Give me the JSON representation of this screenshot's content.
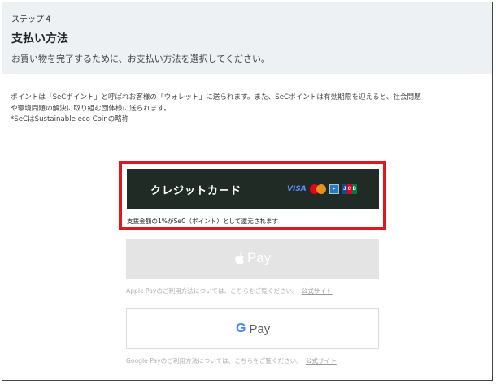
{
  "header": {
    "step": "ステップ４",
    "title": "支払い方法",
    "subtitle": "お買い物を完了するために、お支払い方法を選択してください。"
  },
  "description": {
    "line1": "ポイントは「SeCポイント」と呼ばれお客様の「ウォレット」に送られます。また、SeCポイントは有効期限を迎えると、社会問題",
    "line2": "や環境問題の解決に取り組む団体様に送られます。",
    "line3": "*SeCはSustainable eco Coinの略称"
  },
  "credit_card": {
    "label": "クレジットカード",
    "visa": "VISA",
    "jcb": [
      "J",
      "C",
      "B"
    ],
    "note": "支援金額の1%がSeC（ポイント）として還元されます"
  },
  "apple_pay": {
    "label": "Pay",
    "note": "Apple Payのご利用方法については、こちらをご覧ください。",
    "link": "公式サイト"
  },
  "google_pay": {
    "g": "G",
    "label": "Pay",
    "note": "Google Payのご利用方法については、こちらをご覧ください。",
    "link": "公式サイト"
  },
  "colors": {
    "highlight": "#e0171f",
    "credit_button": "#1f2b24",
    "header_bg": "#eef1f4"
  }
}
